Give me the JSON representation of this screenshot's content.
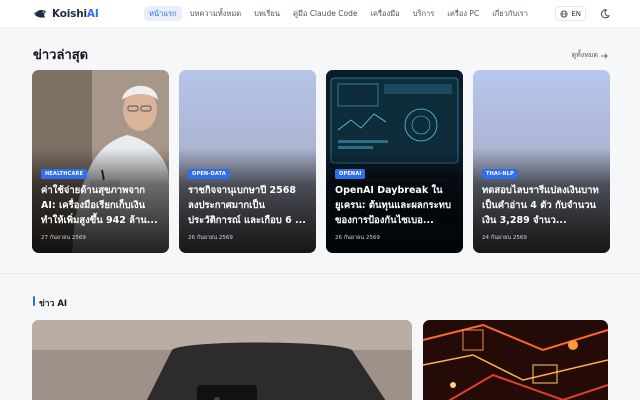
{
  "brand": {
    "name_prefix": "Koishi",
    "name_suffix": "AI"
  },
  "nav": {
    "items": [
      "หน้าแรก",
      "บทความทั้งหมด",
      "บทเรียน",
      "คู่มือ Claude Code",
      "เครื่องมือ",
      "บริการ",
      "เครื่อง PC",
      "เกี่ยวกับเรา"
    ],
    "active_index": 0,
    "lang_label": "EN"
  },
  "latest": {
    "title": "ข่าวล่าสุด",
    "see_all_label": "ดูทั้งหมด",
    "cards": [
      {
        "tag": "HEALTHCARE",
        "title": "ค่าใช้จ่ายด้านสุขภาพจาก AI: เครื่องมือเรียกเก็บเงินทำให้เพิ่มสูงขึ้น 942 ล้าน...",
        "date": "27 กันยายน 2569"
      },
      {
        "tag": "OPEN-DATA",
        "title": "ราชกิจจานุเบกษาปี 2568 ลงประกาศมากเป็นประวัติการณ์ และเกือบ 6 ...",
        "date": "26 กันยายน 2569"
      },
      {
        "tag": "OPENAI",
        "title": "OpenAI Daybreak ในยูเครน: ต้นทุนและผลกระทบของการป้องกันไซเบอ...",
        "date": "26 กันยายน 2569"
      },
      {
        "tag": "THAI-NLP",
        "title": "ทดสอบไลบรารีแปลงเงินบาทเป็นคำอ่าน 4 ตัว กับจำนวนเงิน 3,289 จำนว...",
        "date": "24 กันยายน 2569"
      }
    ]
  },
  "ai_news": {
    "title": "ข่าว AI"
  },
  "colors": {
    "accent": "#2f6fed",
    "tag_bg": "#2f6fed"
  }
}
